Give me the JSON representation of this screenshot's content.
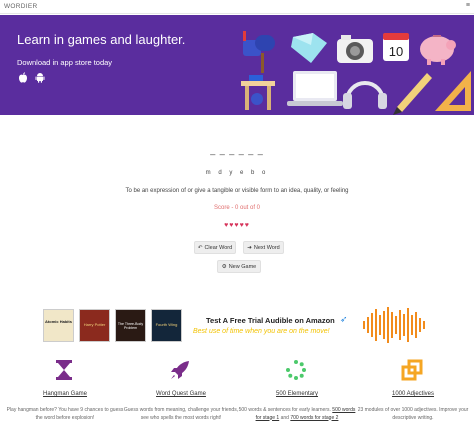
{
  "header": {
    "brand": "WORDIER",
    "menu_icon": "hamburger-menu-icon"
  },
  "hero": {
    "title": "Learn in games and laughter.",
    "subtitle": "Download in app store today",
    "store_icons": [
      "apple-icon",
      "android-icon"
    ],
    "background": "#5a2d9e"
  },
  "game": {
    "blanks": "_ _ _ _ _ _",
    "letters": "m d y e b o",
    "definition": "To be an expression of or give a tangible or visible form to an idea, quality, or feeling",
    "score": "Score - 0 out of 0",
    "hearts": "♥♥♥♥♥",
    "buttons": {
      "clear": "Clear Word",
      "next": "Next Word",
      "new_game": "New Game"
    }
  },
  "ad": {
    "books": [
      "Atomic Habits",
      "Harry Potter",
      "The Three-Body Problem",
      "Fourth Wing"
    ],
    "title": "Test A Free Trial Audible on Amazon",
    "subtitle": "Best use of time when you are on the move!"
  },
  "features": [
    {
      "title": "Hangman Game",
      "desc": "Play hangman before? You have 9 chances to guess the word before explosion!",
      "icon": "hourglass-icon"
    },
    {
      "title": "Word Quest Game",
      "desc": "Guess words from meaning, challenge your friends, see who spells the most words right!",
      "icon": "rocket-icon"
    },
    {
      "title": "500 Elementary",
      "desc_pre": "500 words & sentences for early learners. ",
      "link1": "500 words for stage 1",
      "desc_mid": " and ",
      "link2": "700 words for stage 2",
      "icon": "spinner-icon"
    },
    {
      "title": "1000 Adjectives",
      "desc": "23 modules of over 1000 adjectives. Improve your descriptive writing.",
      "icon": "copy-squares-icon"
    }
  ],
  "colors": {
    "accent": "#5a2d9e",
    "feature_icon": "#7a2d8a",
    "score": "#e06d6d",
    "hearts": "#d6335a",
    "ad_yellow": "#f2c200",
    "wave": "#f28c1c",
    "adj_icon": "#f5a623",
    "spinner": "#4cc96b"
  }
}
